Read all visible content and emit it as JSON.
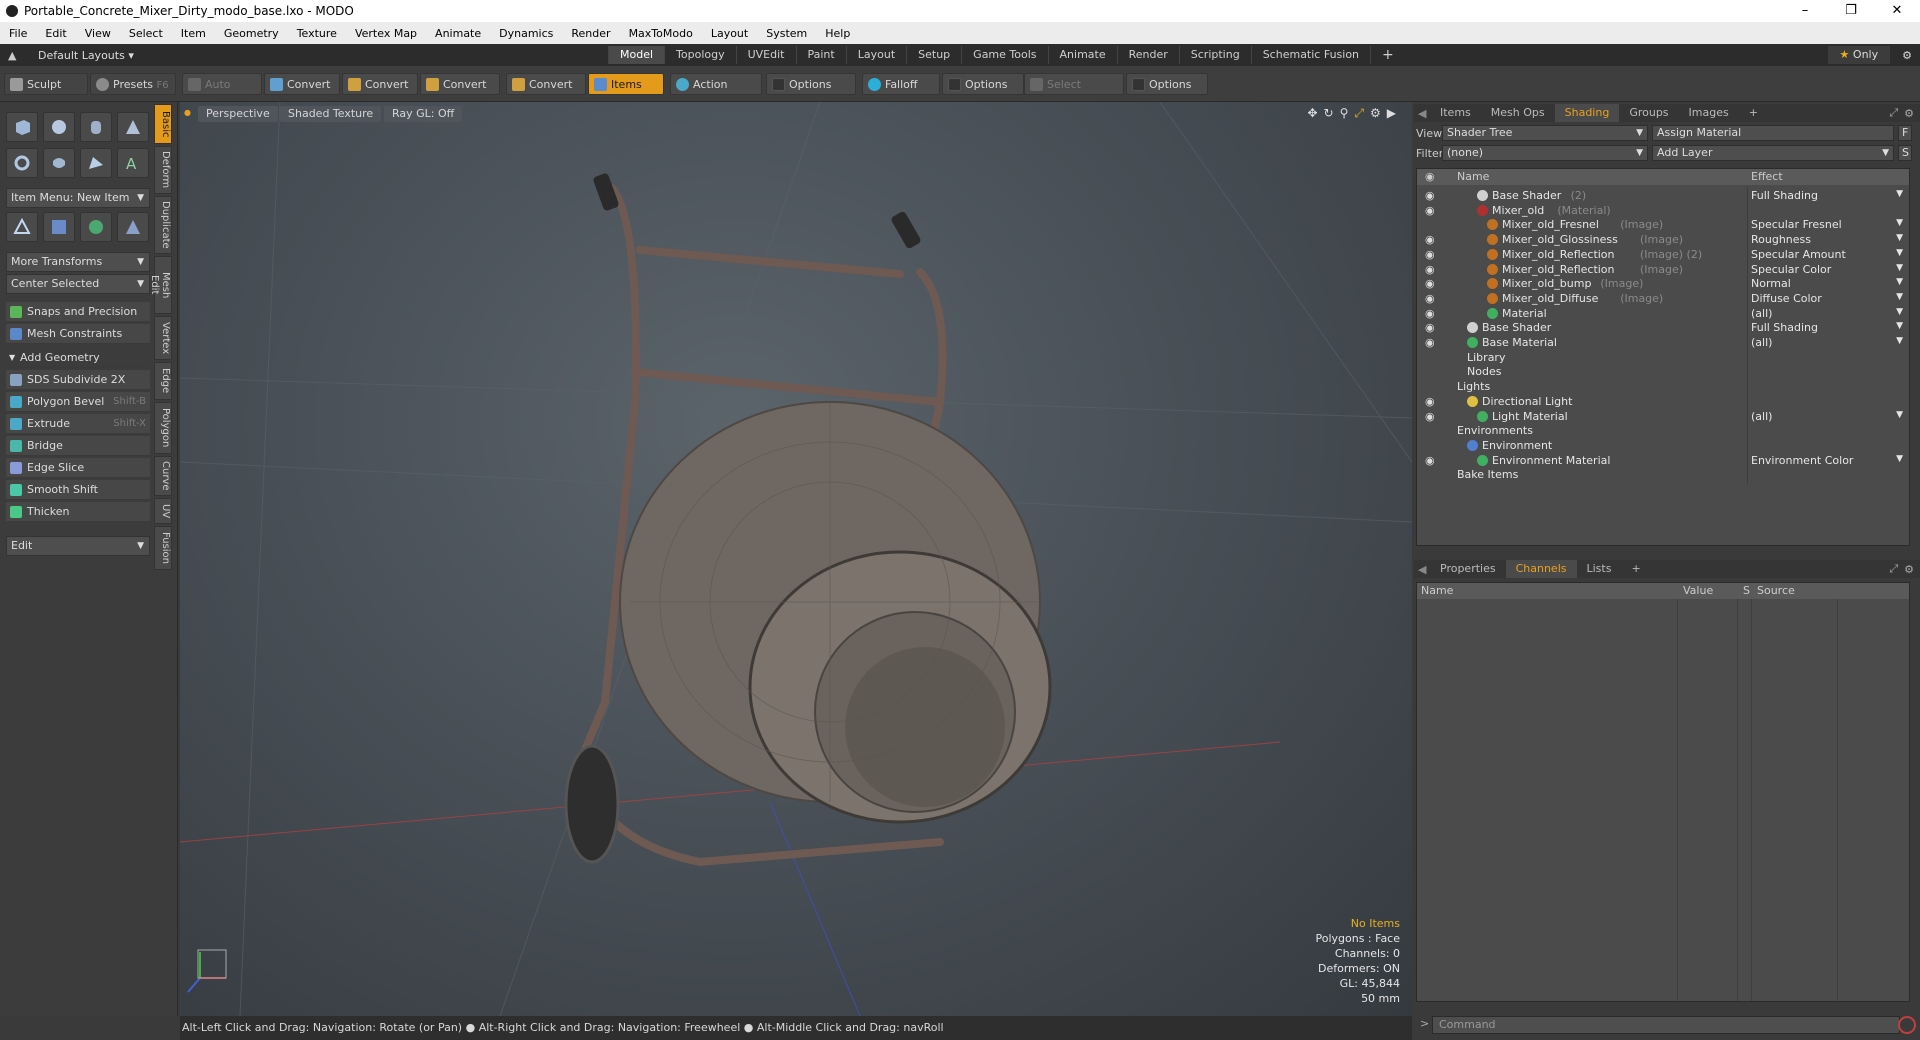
{
  "window": {
    "title": "Portable_Concrete_Mixer_Dirty_modo_base.lxo - MODO"
  },
  "menu": [
    "File",
    "Edit",
    "View",
    "Select",
    "Item",
    "Geometry",
    "Texture",
    "Vertex Map",
    "Animate",
    "Dynamics",
    "Render",
    "MaxToModo",
    "Layout",
    "System",
    "Help"
  ],
  "layout_bar": {
    "layouts_label": "Default Layouts",
    "tabs": [
      "Model",
      "Topology",
      "UVEdit",
      "Paint",
      "Layout",
      "Setup",
      "Game Tools",
      "Animate",
      "Render",
      "Scripting",
      "Schematic Fusion"
    ],
    "active_tab": "Model",
    "only_label": "Only"
  },
  "toolbar": {
    "sculpt": "Sculpt",
    "presets": "Presets",
    "presets_key": "F6",
    "auto_select": "Auto Select",
    "convert1": "Convert",
    "convert2": "Convert",
    "convert3": "Convert",
    "convert4": "Convert",
    "items": "Items",
    "action_center": "Action Center",
    "options1": "Options",
    "falloff": "Falloff",
    "options2": "Options",
    "select_through": "Select Through",
    "options3": "Options"
  },
  "left_panel": {
    "item_menu": "Item Menu: New Item",
    "more_transforms": "More Transforms",
    "center_selected": "Center Selected",
    "snaps": "Snaps and Precision",
    "mesh_constraints": "Mesh Constraints",
    "add_geometry": "Add Geometry",
    "tools": [
      {
        "label": "SDS Subdivide 2X",
        "shortcut": "",
        "color": "#8aa0c0"
      },
      {
        "label": "Polygon Bevel",
        "shortcut": "Shift-B",
        "color": "#4aa8c8"
      },
      {
        "label": "Extrude",
        "shortcut": "Shift-X",
        "color": "#4aa8c8"
      },
      {
        "label": "Bridge",
        "shortcut": "",
        "color": "#4ab8a8"
      },
      {
        "label": "Edge Slice",
        "shortcut": "",
        "color": "#8a9ad8"
      },
      {
        "label": "Smooth Shift",
        "shortcut": "",
        "color": "#4ac8a8"
      },
      {
        "label": "Thicken",
        "shortcut": "",
        "color": "#4ac888"
      }
    ],
    "edit_dropdown": "Edit",
    "vertical_tabs": [
      "Basic",
      "Deform",
      "Duplicate",
      "Mesh Edit",
      "Vertex",
      "Edge",
      "Polygon",
      "Curve",
      "UV",
      "Fusion"
    ]
  },
  "viewport": {
    "view_mode": "Perspective",
    "shading": "Shaded Texture",
    "raygl": "Ray GL: Off",
    "info": {
      "items": "No Items",
      "polygons": "Polygons : Face",
      "channels": "Channels: 0",
      "deformers": "Deformers: ON",
      "gl": "GL: 45,844",
      "lens": "50 mm"
    }
  },
  "status_bar": "Alt-Left Click and Drag: Navigation: Rotate (or Pan) ● Alt-Right Click and Drag: Navigation: Freewheel ● Alt-Middle Click and Drag: navRoll",
  "right_panel": {
    "top_tabs": [
      "Items",
      "Mesh Ops",
      "Shading",
      "Groups",
      "Images"
    ],
    "active_top_tab": "Shading",
    "view_label": "View",
    "view_value": "Shader Tree",
    "assign_material": "Assign Material",
    "filter_label": "Filter",
    "filter_value": "(none)",
    "add_layer": "Add Layer",
    "col_name": "Name",
    "col_effect": "Effect",
    "tree": [
      {
        "name": "Base Shader",
        "sub": "(2)",
        "effect": "Full Shading",
        "indent": 2,
        "eye": true,
        "ball": "#d0d0d0"
      },
      {
        "name": "Mixer_old",
        "sub": "(Material)",
        "effect": "",
        "indent": 2,
        "eye": true,
        "ball": "#b03030"
      },
      {
        "name": "Mixer_old_Fresnel",
        "sub": "(Image)",
        "effect": "Specular Fresnel",
        "indent": 3,
        "eye": false,
        "ball": "#c07020"
      },
      {
        "name": "Mixer_old_Glossiness",
        "sub": "(Image)",
        "effect": "Roughness",
        "indent": 3,
        "eye": true,
        "ball": "#c07020"
      },
      {
        "name": "Mixer_old_Reflection",
        "sub": "(Image) (2)",
        "effect": "Specular Amount",
        "indent": 3,
        "eye": true,
        "ball": "#c07020"
      },
      {
        "name": "Mixer_old_Reflection",
        "sub": "(Image)",
        "effect": "Specular Color",
        "indent": 3,
        "eye": true,
        "ball": "#c07020"
      },
      {
        "name": "Mixer_old_bump",
        "sub": "(Image)",
        "effect": "Normal",
        "indent": 3,
        "eye": true,
        "ball": "#c07020"
      },
      {
        "name": "Mixer_old_Diffuse",
        "sub": "(Image)",
        "effect": "Diffuse Color",
        "indent": 3,
        "eye": true,
        "ball": "#c07020"
      },
      {
        "name": "Material",
        "sub": "",
        "effect": "(all)",
        "indent": 3,
        "eye": true,
        "ball": "#40b060"
      },
      {
        "name": "Base Shader",
        "sub": "",
        "effect": "Full Shading",
        "indent": 1,
        "eye": true,
        "ball": "#d0d0d0"
      },
      {
        "name": "Base Material",
        "sub": "",
        "effect": "(all)",
        "indent": 1,
        "eye": true,
        "ball": "#40b060"
      },
      {
        "name": "Library",
        "sub": "",
        "effect": "",
        "indent": 1,
        "eye": false,
        "ball": ""
      },
      {
        "name": "Nodes",
        "sub": "",
        "effect": "",
        "indent": 1,
        "eye": false,
        "ball": ""
      },
      {
        "name": "Lights",
        "sub": "",
        "effect": "",
        "indent": 0,
        "eye": false,
        "ball": ""
      },
      {
        "name": "Directional Light",
        "sub": "",
        "effect": "",
        "indent": 1,
        "eye": true,
        "ball": "#e0c040"
      },
      {
        "name": "Light Material",
        "sub": "",
        "effect": "(all)",
        "indent": 2,
        "eye": true,
        "ball": "#40b060"
      },
      {
        "name": "Environments",
        "sub": "",
        "effect": "",
        "indent": 0,
        "eye": false,
        "ball": ""
      },
      {
        "name": "Environment",
        "sub": "",
        "effect": "",
        "indent": 1,
        "eye": false,
        "ball": "#5080d0"
      },
      {
        "name": "Environment Material",
        "sub": "",
        "effect": "Environment Color",
        "indent": 2,
        "eye": true,
        "ball": "#40b060"
      },
      {
        "name": "Bake Items",
        "sub": "",
        "effect": "",
        "indent": 0,
        "eye": false,
        "ball": ""
      }
    ],
    "bottom_tabs": [
      "Properties",
      "Channels",
      "Lists"
    ],
    "active_bottom_tab": "Channels",
    "ch_cols": {
      "name": "Name",
      "value": "Value",
      "s": "S",
      "source": "Source"
    },
    "command_placeholder": "Command"
  },
  "colors": {
    "accent": "#e49a1a"
  }
}
